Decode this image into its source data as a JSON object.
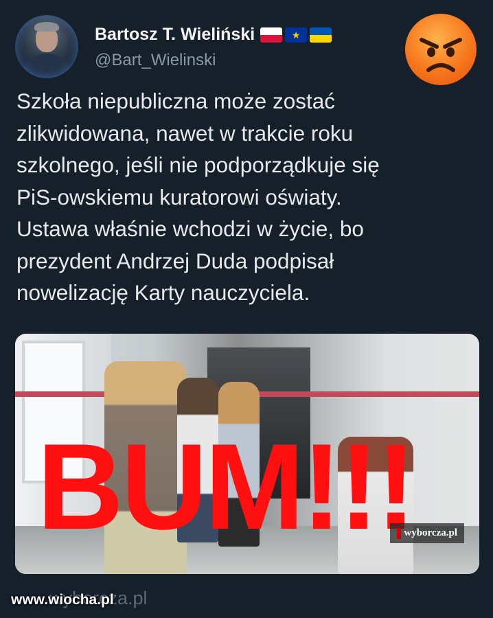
{
  "author": {
    "display_name": "Bartosz T. Wieliński",
    "handle": "@Bart_Wielinski",
    "flags": [
      "poland-flag-icon",
      "eu-flag-icon",
      "ukraine-flag-icon"
    ]
  },
  "reaction_emoji": "angry-face-icon",
  "tweet": {
    "lines": [
      "Szkoła niepubliczna może zostać",
      "zlikwidowana, nawet w trakcie roku",
      "szkolnego, jeśli nie podporządkuje się",
      "PiS-owskiemu kuratorowi oświaty.",
      "Ustawa właśnie wchodzi w życie, bo",
      "prezydent Andrzej Duda podpisał",
      "nowelizację Karty nauczyciela."
    ]
  },
  "media": {
    "overlay_text": "BUM!!!",
    "source_watermark": "wyborcza.pl"
  },
  "link_card": {
    "domain": "wyborcza.pl"
  },
  "site_watermark": "www.wiocha.pl",
  "colors": {
    "background": "#15202b",
    "overlay_red": "#ff1010",
    "handle_gray": "#8b98a5"
  }
}
